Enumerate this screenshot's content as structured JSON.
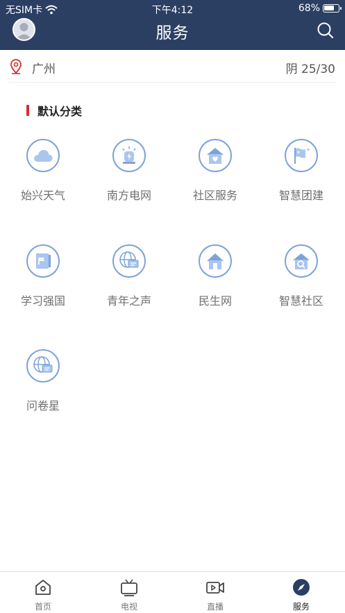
{
  "status_bar": {
    "carrier": "无SIM卡",
    "time": "下午4:12",
    "battery": "68%"
  },
  "header": {
    "title": "服务"
  },
  "location": {
    "city": "广州",
    "weather": "阴 25/30"
  },
  "category": {
    "title": "默认分类"
  },
  "services": [
    {
      "label": "始兴天气",
      "icon": "cloud-icon"
    },
    {
      "label": "南方电网",
      "icon": "power-alert-icon"
    },
    {
      "label": "社区服务",
      "icon": "house-heart-icon"
    },
    {
      "label": "智慧团建",
      "icon": "flag-icon"
    },
    {
      "label": "学习强国",
      "icon": "book-flag-icon"
    },
    {
      "label": "青年之声",
      "icon": "globe-message-icon"
    },
    {
      "label": "民生网",
      "icon": "house-icon"
    },
    {
      "label": "智慧社区",
      "icon": "house-search-icon"
    },
    {
      "label": "问卷星",
      "icon": "globe-message-icon"
    }
  ],
  "tabs": [
    {
      "label": "首页",
      "icon": "home-icon"
    },
    {
      "label": "电视",
      "icon": "tv-icon"
    },
    {
      "label": "直播",
      "icon": "video-icon"
    },
    {
      "label": "服务",
      "icon": "compass-icon",
      "active": true
    }
  ],
  "colors": {
    "header_bg": "#2b3f63",
    "icon_blue": "#7ea3d8",
    "category_bar": "#d32f2f"
  }
}
